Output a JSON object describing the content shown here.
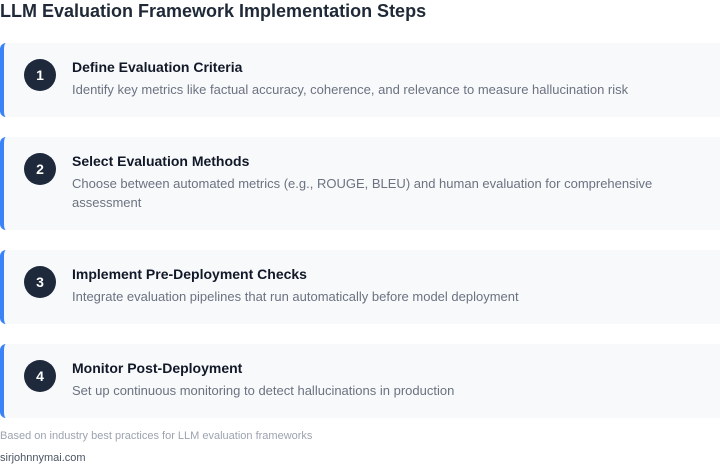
{
  "title": "LLM Evaluation Framework Implementation Steps",
  "steps": [
    {
      "number": "1",
      "title": "Define Evaluation Criteria",
      "description": "Identify key metrics like factual accuracy, coherence, and relevance to measure hallucination risk"
    },
    {
      "number": "2",
      "title": "Select Evaluation Methods",
      "description": "Choose between automated metrics (e.g., ROUGE, BLEU) and human evaluation for comprehensive assessment"
    },
    {
      "number": "3",
      "title": "Implement Pre-Deployment Checks",
      "description": "Integrate evaluation pipelines that run automatically before model deployment"
    },
    {
      "number": "4",
      "title": "Monitor Post-Deployment",
      "description": "Set up continuous monitoring to detect hallucinations in production"
    }
  ],
  "footnote": "Based on industry best practices for LLM evaluation frameworks",
  "credit": "sirjohnnymai.com",
  "colors": {
    "accent": "#3b82f6",
    "badge": "#1e293b",
    "card_background": "#f8f9fb"
  }
}
